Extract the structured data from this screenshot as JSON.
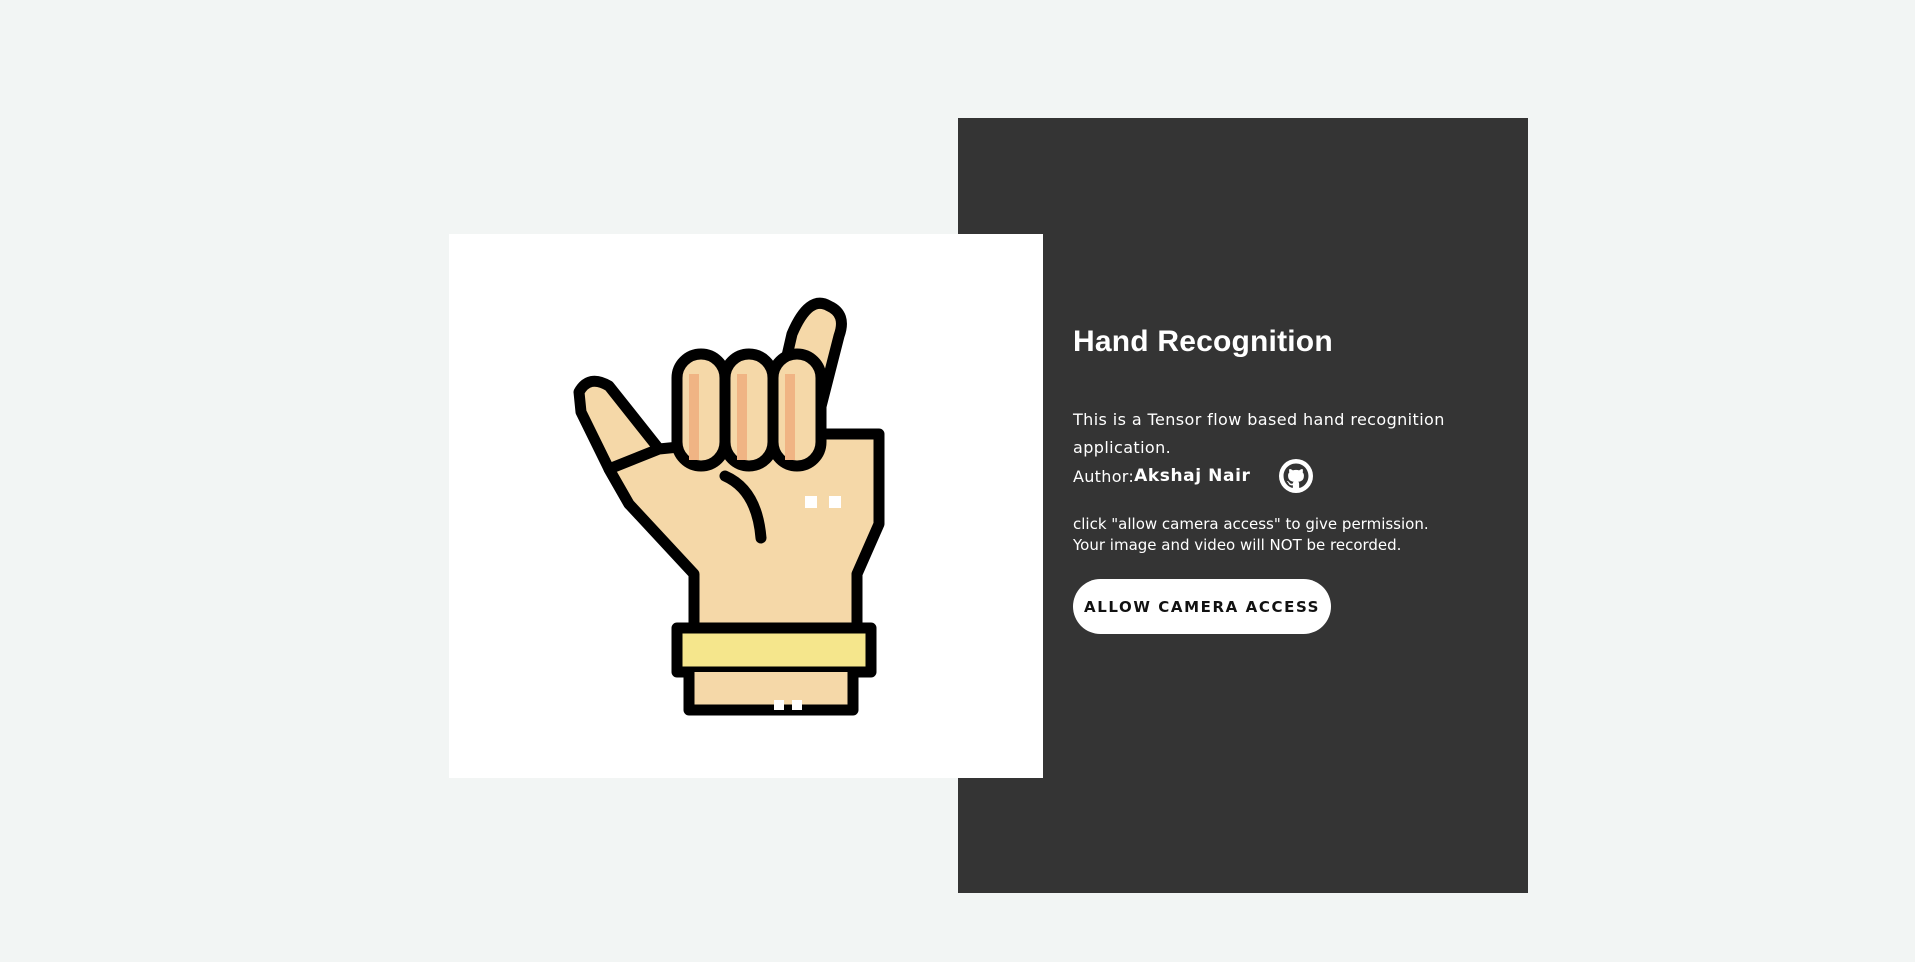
{
  "hero": {
    "title": "Hand Recognition",
    "description": "This is a Tensor flow based hand recognition application.",
    "author_label": "Author:",
    "author_name": "Akshaj Nair",
    "notice": "click \"allow camera access\" to give permission. Your image and video will NOT be recorded.",
    "button_label": "ALLOW CAMERA ACCESS",
    "github_icon": "github-icon",
    "illustration_icon": "shaka-hand-icon"
  },
  "colors": {
    "page_background": "#f2f5f4",
    "panel_background": "#343434",
    "card_background": "#ffffff",
    "skin": "#f5d8a8",
    "skin_shadow": "#f0b484",
    "bracelet": "#f5e68c",
    "outline": "#000000"
  }
}
